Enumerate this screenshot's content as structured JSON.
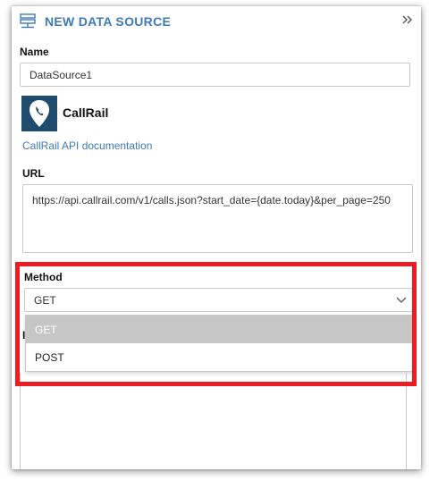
{
  "header": {
    "title": "NEW DATA SOURCE"
  },
  "form": {
    "name_label": "Name",
    "name_value": "DataSource1",
    "provider_name": "CallRail",
    "doc_link": "CallRail API documentation",
    "url_label": "URL",
    "url_value": "https://api.callrail.com/v1/calls.json?start_date={date.today}&per_page=250",
    "method_label": "Method",
    "method_value": "GET",
    "method_options": [
      "GET",
      "POST"
    ]
  },
  "colors": {
    "accent": "#3d7ab8",
    "highlight": "#ea1c24",
    "selected_option_bg": "#c6c6c6",
    "logo_bg": "#1f4b6e"
  }
}
